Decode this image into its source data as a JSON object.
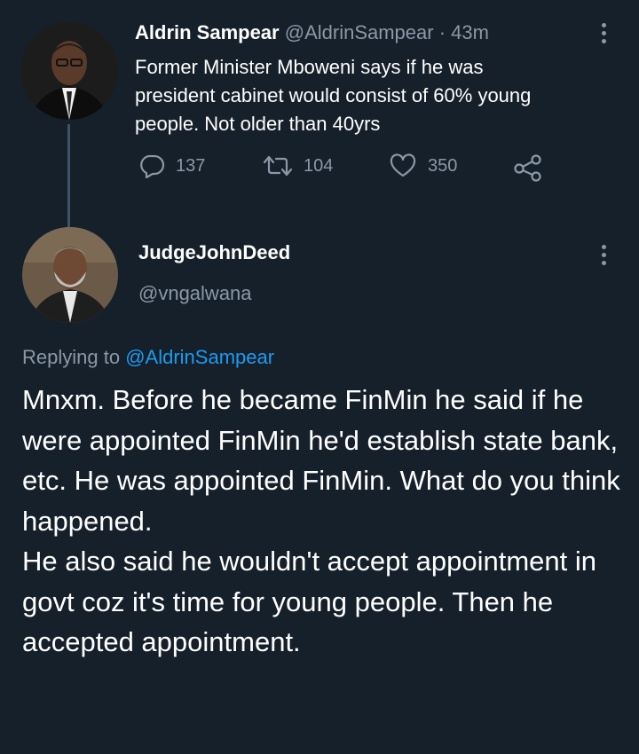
{
  "parent_tweet": {
    "display_name": "Aldrin Sampear",
    "handle": "@AldrinSampear",
    "separator": "·",
    "time": "43m",
    "text": "Former Minister Mboweni says if he was\npresident cabinet would consist of 60% young\npeople. Not older than 40yrs",
    "replies": "137",
    "retweets": "104",
    "likes": "350"
  },
  "reply_tweet": {
    "display_name": "JudgeJohnDeed",
    "handle": "@vngalwana",
    "replying_prefix": "Replying to",
    "replying_to": "@AldrinSampear",
    "paragraphs": [
      "Mnxm. Before he became FinMin he said if he were appointed FinMin he'd establish state bank, etc. He was appointed FinMin. What do you think happened.",
      "He also said he wouldn't accept appointment in govt coz it's time for young people. Then he accepted appointment."
    ]
  },
  "colors": {
    "background": "#15202b",
    "text": "#ffffff",
    "muted": "#8b98a5",
    "link": "#1d9bf0",
    "thread_line": "#3d5466"
  },
  "icons": [
    "reply-icon",
    "retweet-icon",
    "like-icon",
    "share-icon",
    "more-options-icon"
  ]
}
